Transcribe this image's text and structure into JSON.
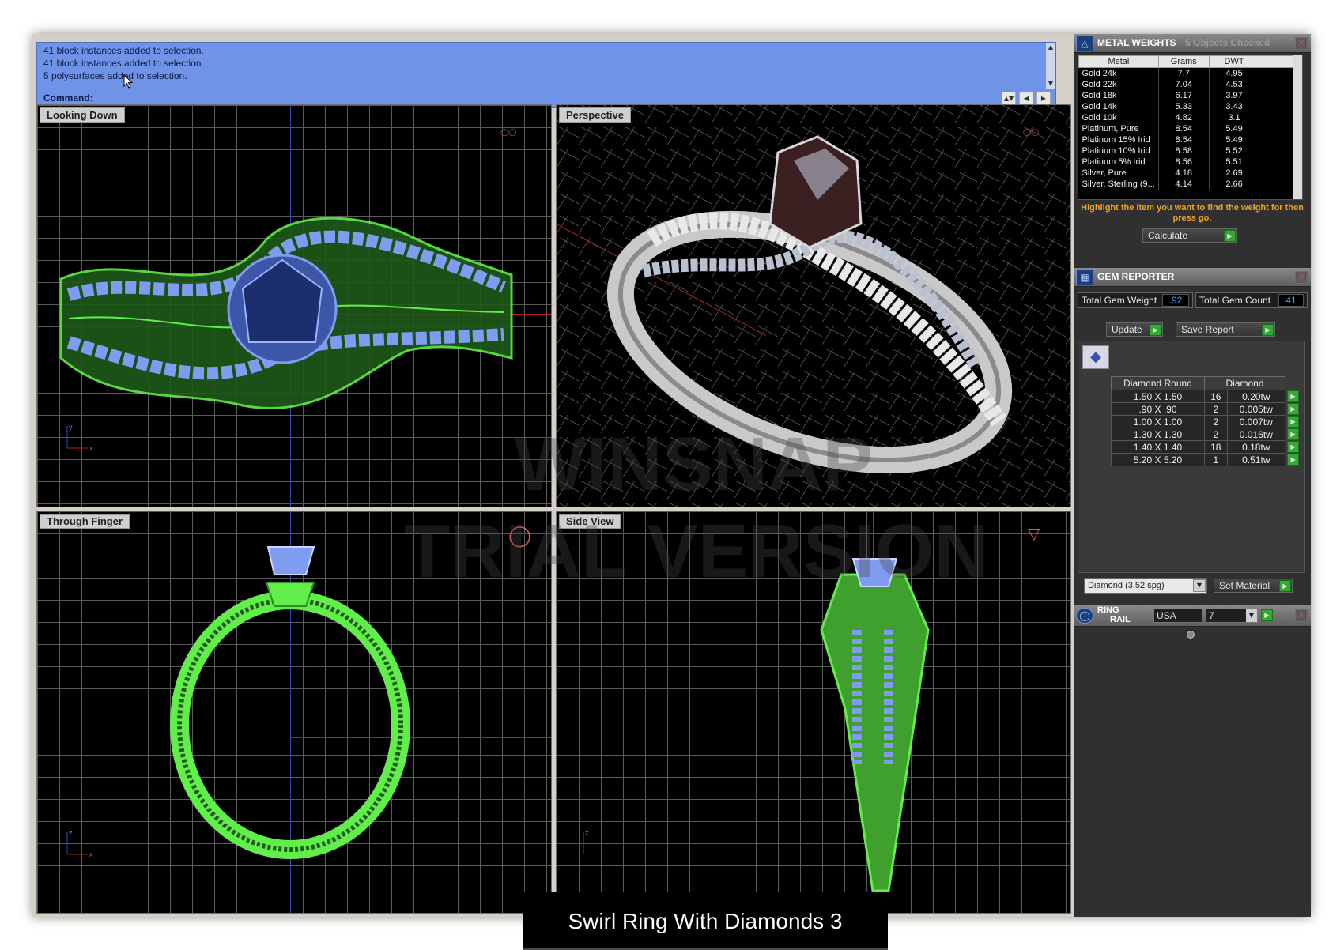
{
  "command": {
    "history": [
      "41 block instances added to selection.",
      "41 block instances added to selection.",
      "5 polysurfaces added to selection."
    ],
    "prompt_label": "Command:"
  },
  "viewports": {
    "top_left": "Looking Down",
    "top_right": "Perspective",
    "bottom_left": "Through Finger",
    "bottom_right": "Side View"
  },
  "watermark": [
    "WINSNAP",
    "TRIAL VERSION"
  ],
  "caption": "Swirl Ring With Diamonds 3",
  "metal_weights": {
    "title": "METAL WEIGHTS",
    "status": "5 Objects Checked",
    "columns": [
      "Metal",
      "Grams",
      "DWT"
    ],
    "rows": [
      [
        "Gold 24k",
        "7.7",
        "4.95"
      ],
      [
        "Gold 22k",
        "7.04",
        "4.53"
      ],
      [
        "Gold 18k",
        "6.17",
        "3.97"
      ],
      [
        "Gold 14k",
        "5.33",
        "3.43"
      ],
      [
        "Gold 10k",
        "4.82",
        "3.1"
      ],
      [
        "Platinum, Pure",
        "8.54",
        "5.49"
      ],
      [
        "Platinum 15% Irid",
        "8.54",
        "5.49"
      ],
      [
        "Platinum 10% Irid",
        "8.58",
        "5.52"
      ],
      [
        "Platinum 5% Irid",
        "8.56",
        "5.51"
      ],
      [
        "Silver, Pure",
        "4.18",
        "2.69"
      ],
      [
        "Silver, Sterling (9...",
        "4.14",
        "2.66"
      ]
    ],
    "hint": "Highlight the item you want to find the weight for then press go.",
    "calculate_label": "Calculate"
  },
  "gem_reporter": {
    "title": "GEM REPORTER",
    "total_weight_label": "Total Gem Weight",
    "total_weight_value": ".92",
    "total_count_label": "Total Gem Count",
    "total_count_value": "41",
    "update_label": "Update",
    "save_report_label": "Save Report",
    "columns": [
      "Diamond Round",
      "Diamond"
    ],
    "rows": [
      [
        "1.50 X 1.50",
        "16",
        "0.20tw"
      ],
      [
        ".90 X .90",
        "2",
        "0.005tw"
      ],
      [
        "1.00 X 1.00",
        "2",
        "0.007tw"
      ],
      [
        "1.30 X 1.30",
        "2",
        "0.016tw"
      ],
      [
        "1.40 X 1.40",
        "18",
        "0.18tw"
      ],
      [
        "5.20 X 5.20",
        "1",
        "0.51tw"
      ]
    ],
    "material_select": "Diamond    (3.52 spg)",
    "set_material_label": "Set Material"
  },
  "ring_rail": {
    "title_line1": "RING",
    "title_line2": "RAIL",
    "country": "USA",
    "size": "7"
  },
  "colors": {
    "command_bg": "#6f93e6",
    "wire_green": "#62ee4a",
    "gem_blue": "#7f9cf0",
    "hint_orange": "#f0a020",
    "go_green": "#35a835"
  },
  "icons": [
    "cursor-arrow-icon",
    "metal-weights-icon",
    "gem-reporter-icon",
    "ring-rail-icon",
    "close-icon",
    "go-arrow-icon",
    "dropdown-arrow-icon",
    "scroll-arrow-icon"
  ]
}
